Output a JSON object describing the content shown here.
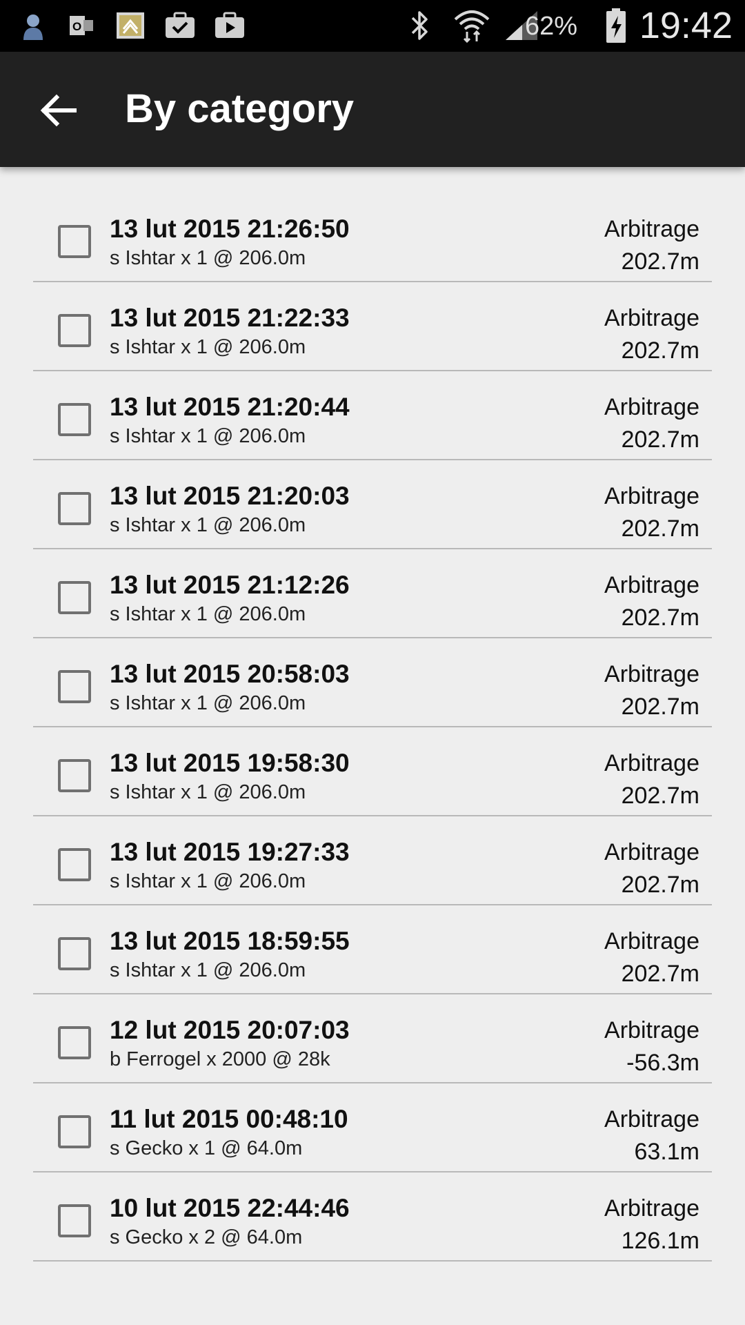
{
  "status_bar": {
    "icons": [
      "avatar-icon",
      "outlook-icon",
      "inbox-icon",
      "briefcase-check-icon",
      "briefcase-play-icon",
      "bluetooth-icon",
      "wifi-icon",
      "signal-icon",
      "battery-charging-icon"
    ],
    "battery_percent": "62%",
    "time": "19:42"
  },
  "app_bar": {
    "title": "By category",
    "back_icon": "arrow-back-icon"
  },
  "transactions": [
    {
      "date": "13 lut 2015 21:26:50",
      "detail": "s Ishtar x 1 @ 206.0m",
      "category": "Arbitrage",
      "amount": "202.7m",
      "checked": false
    },
    {
      "date": "13 lut 2015 21:22:33",
      "detail": "s Ishtar x 1 @ 206.0m",
      "category": "Arbitrage",
      "amount": "202.7m",
      "checked": false
    },
    {
      "date": "13 lut 2015 21:20:44",
      "detail": "s Ishtar x 1 @ 206.0m",
      "category": "Arbitrage",
      "amount": "202.7m",
      "checked": false
    },
    {
      "date": "13 lut 2015 21:20:03",
      "detail": "s Ishtar x 1 @ 206.0m",
      "category": "Arbitrage",
      "amount": "202.7m",
      "checked": false
    },
    {
      "date": "13 lut 2015 21:12:26",
      "detail": "s Ishtar x 1 @ 206.0m",
      "category": "Arbitrage",
      "amount": "202.7m",
      "checked": false
    },
    {
      "date": "13 lut 2015 20:58:03",
      "detail": "s Ishtar x 1 @ 206.0m",
      "category": "Arbitrage",
      "amount": "202.7m",
      "checked": false
    },
    {
      "date": "13 lut 2015 19:58:30",
      "detail": "s Ishtar x 1 @ 206.0m",
      "category": "Arbitrage",
      "amount": "202.7m",
      "checked": false
    },
    {
      "date": "13 lut 2015 19:27:33",
      "detail": "s Ishtar x 1 @ 206.0m",
      "category": "Arbitrage",
      "amount": "202.7m",
      "checked": false
    },
    {
      "date": "13 lut 2015 18:59:55",
      "detail": "s Ishtar x 1 @ 206.0m",
      "category": "Arbitrage",
      "amount": "202.7m",
      "checked": false
    },
    {
      "date": "12 lut 2015 20:07:03",
      "detail": "b Ferrogel x 2000 @ 28k",
      "category": "Arbitrage",
      "amount": "-56.3m",
      "checked": false
    },
    {
      "date": "11 lut 2015 00:48:10",
      "detail": "s Gecko x 1 @ 64.0m",
      "category": "Arbitrage",
      "amount": "63.1m",
      "checked": false
    },
    {
      "date": "10 lut 2015 22:44:46",
      "detail": "s Gecko x 2 @ 64.0m",
      "category": "Arbitrage",
      "amount": "126.1m",
      "checked": false
    }
  ]
}
